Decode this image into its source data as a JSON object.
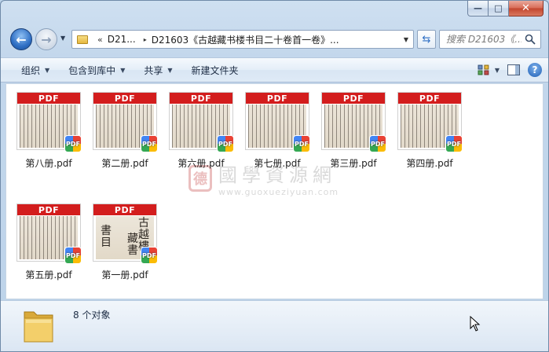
{
  "window": {
    "caption": {
      "minimize": "—",
      "maximize": "□",
      "close": "✕"
    }
  },
  "address_bar": {
    "chevron": "«",
    "segments": [
      "D21...",
      "D21603《古越藏书楼书目二十卷首一卷》..."
    ],
    "separator": "▸"
  },
  "search": {
    "placeholder": "搜索 D21603《..."
  },
  "toolbar": {
    "organize": "组织",
    "include_in_library": "包含到库中",
    "share": "共享",
    "new_folder": "新建文件夹"
  },
  "files": [
    {
      "name": "第八册.pdf",
      "band": "PDF",
      "badge": "PDF",
      "cover": false
    },
    {
      "name": "第二册.pdf",
      "band": "PDF",
      "badge": "PDF",
      "cover": false
    },
    {
      "name": "第六册.pdf",
      "band": "PDF",
      "badge": "PDF",
      "cover": false
    },
    {
      "name": "第七册.pdf",
      "band": "PDF",
      "badge": "PDF",
      "cover": false
    },
    {
      "name": "第三册.pdf",
      "band": "PDF",
      "badge": "PDF",
      "cover": false
    },
    {
      "name": "第四册.pdf",
      "band": "PDF",
      "badge": "PDF",
      "cover": false
    },
    {
      "name": "第五册.pdf",
      "band": "PDF",
      "badge": "PDF",
      "cover": false
    },
    {
      "name": "第一册.pdf",
      "band": "PDF",
      "badge": "PDF",
      "cover": true,
      "cover_text": [
        "古",
        "越",
        "藏",
        "書",
        "樓",
        "書",
        "目"
      ]
    }
  ],
  "watermark": {
    "seal": "德",
    "name": "國學資源網",
    "url": "www.guoxueziyuan.com"
  },
  "status": {
    "item_count": "8 个对象"
  },
  "colors": {
    "pdf_band": "#d31d1d",
    "window_frame": "#bcd3ea",
    "close_button": "#c2452d"
  }
}
